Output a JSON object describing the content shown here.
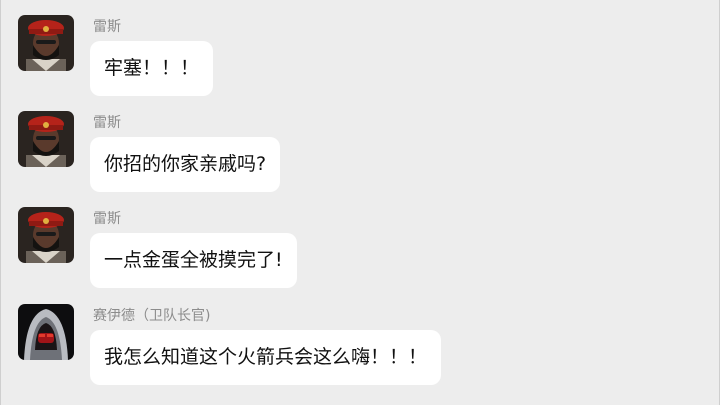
{
  "messages": [
    {
      "sender": "雷斯",
      "text": "牢塞！！！",
      "avatar_icon": "bearded-man-red-beret-icon"
    },
    {
      "sender": "雷斯",
      "text": "你招的你家亲戚吗?",
      "avatar_icon": "bearded-man-red-beret-icon"
    },
    {
      "sender": "雷斯",
      "text": "一点金蛋全被摸完了!",
      "avatar_icon": "bearded-man-red-beret-icon"
    },
    {
      "sender": "赛伊德（卫队长官)",
      "text": "我怎么知道这个火箭兵会这么嗨！！！",
      "avatar_icon": "hooded-masked-figure-icon"
    }
  ],
  "colors": {
    "background": "#ededed",
    "bubble": "#ffffff",
    "sender_text": "#8c8c8c",
    "message_text": "#111111"
  }
}
